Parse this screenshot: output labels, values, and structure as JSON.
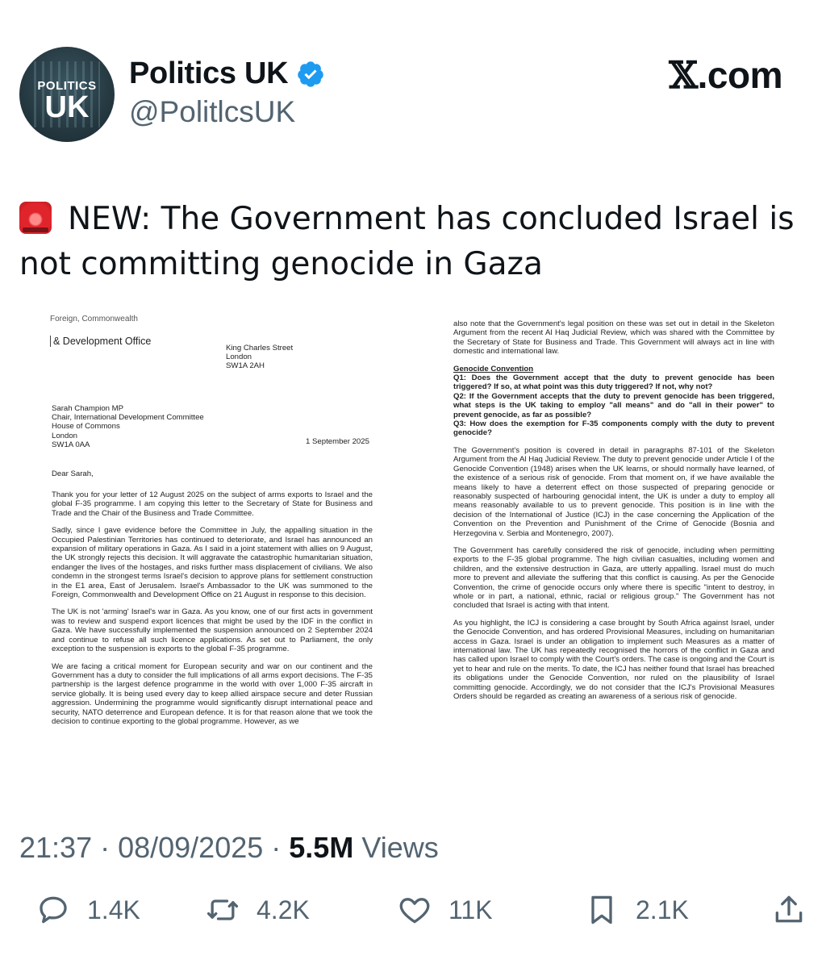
{
  "account": {
    "name": "Politics UK",
    "handle": "@PolitlcsUK",
    "avatar_line1": "POLITICS",
    "avatar_line2": "UK"
  },
  "brand": {
    "mark": "𝕏",
    "suffix": ".com"
  },
  "tweet": {
    "text": "NEW: The Government has concluded Israel is not committing genocide in Gaza",
    "emoji_icon": "police-car-light-icon"
  },
  "letter_left": {
    "header_cut": "Foreign, Commonwealth",
    "office": "& Development Office",
    "address_lines": [
      "King Charles Street",
      "London",
      "SW1A 2AH"
    ],
    "recipient_lines": [
      "Sarah Champion MP",
      "Chair, International Development Committee",
      "House of Commons",
      "London",
      "SW1A 0AA"
    ],
    "date": "1 September 2025",
    "salutation": "Dear Sarah,",
    "paragraphs": [
      "Thank you for your letter of 12 August 2025 on the subject of arms exports to Israel and the global F-35 programme. I am copying this letter to the Secretary of State for Business and Trade and the Chair of the Business and Trade Committee.",
      "Sadly, since I gave evidence before the Committee in July, the appalling situation in the Occupied Palestinian Territories has continued to deteriorate, and Israel has announced an expansion of military operations in Gaza. As I said in a joint statement with allies on 9 August, the UK strongly rejects this decision. It will aggravate the catastrophic humanitarian situation, endanger the lives of the hostages, and risks further mass displacement of civilians. We also condemn in the strongest terms Israel's decision to approve plans for settlement construction in the E1 area, East of Jerusalem. Israel's Ambassador to the UK was summoned to the Foreign, Commonwealth and Development Office on 21 August in response to this decision.",
      "The UK is not 'arming' Israel's war in Gaza. As you know, one of our first acts in government was to review and suspend export licences that might be used by the IDF in the conflict in Gaza. We have successfully implemented the suspension announced on 2 September 2024 and continue to refuse all such licence applications. As set out to Parliament, the only exception to the suspension is exports to the global F-35 programme.",
      "We are facing a critical moment for European security and war on our continent and the Government has a duty to consider the full implications of all arms export decisions. The F-35 partnership is the largest defence programme in the world with over 1,000 F-35 aircraft in service globally. It is being used every day to keep allied airspace secure and deter Russian aggression. Undermining the programme would significantly disrupt international peace and security, NATO deterrence and European defence. It is for that reason alone that we took the decision to continue exporting to the global programme. However, as we"
    ]
  },
  "letter_right": {
    "top_paragraph": "also note that the Government's legal position on these was set out in detail in the Skeleton Argument from the recent Al Haq Judicial Review, which was shared with the Committee by the Secretary of State for Business and Trade. This Government will always act in line with domestic and international law.",
    "heading": "Genocide Convention",
    "questions": [
      "Q1: Does the Government accept that the duty to prevent genocide has been triggered? If so, at what point was this duty triggered? If not, why not?",
      "Q2: If the Government accepts that the duty to prevent genocide has been triggered, what steps is the UK taking to employ \"all means\" and do \"all in their power\" to prevent genocide, as far as possible?",
      "Q3: How does the exemption for F-35 components comply with the duty to prevent genocide?"
    ],
    "paragraphs": [
      "The Government's position is covered in detail in paragraphs 87-101 of the Skeleton Argument from the Al Haq Judicial Review. The duty to prevent genocide under Article I of the Genocide Convention (1948) arises when the UK learns, or should normally have learned, of the existence of a serious risk of genocide. From that moment on, if we have available the means likely to have a deterrent effect on those suspected of preparing genocide or reasonably suspected of harbouring genocidal intent, the UK is under a duty to employ all means reasonably available to us to prevent genocide. This position is in line with the decision of the International of Justice (ICJ) in the case concerning the Application of the Convention on the Prevention and Punishment of the Crime of Genocide (Bosnia and Herzegovina v. Serbia and Montenegro, 2007).",
      "The Government has carefully considered the risk of genocide, including when permitting exports to the F-35 global programme. The high civilian casualties, including women and children, and the extensive destruction in Gaza, are utterly appalling. Israel must do much more to prevent and alleviate the suffering that this conflict is causing. As per the Genocide Convention, the crime of genocide occurs only where there is specific \"intent to destroy, in whole or in part, a national, ethnic, racial or religious group.\" The Government has not concluded that Israel is acting with that intent.",
      "As you highlight, the ICJ is considering a case brought by South Africa against Israel, under the Genocide Convention, and has ordered Provisional Measures, including on humanitarian access in Gaza. Israel is under an obligation to implement such Measures as a matter of international law. The UK has repeatedly recognised the horrors of the conflict in Gaza and has called upon Israel to comply with the Court's orders. The case is ongoing and the Court is yet to hear and rule on the merits. To date, the ICJ has neither found that Israel has breached its obligations under the Genocide Convention, nor ruled on the plausibility of Israel committing genocide. Accordingly, we do not consider that the ICJ's Provisional Measures Orders should be regarded as creating an awareness of a serious risk of genocide."
    ]
  },
  "meta": {
    "time": "21:37",
    "separator": " · ",
    "date": "08/09/2025",
    "views_count": "5.5M",
    "views_label": " Views"
  },
  "actions": {
    "replies": "1.4K",
    "reposts": "4.2K",
    "likes": "11K",
    "bookmarks": "2.1K"
  },
  "colors": {
    "text": "#0f1419",
    "secondary": "#536471",
    "verified": "#1d9bf0",
    "avatar_bg": "#22343c"
  }
}
